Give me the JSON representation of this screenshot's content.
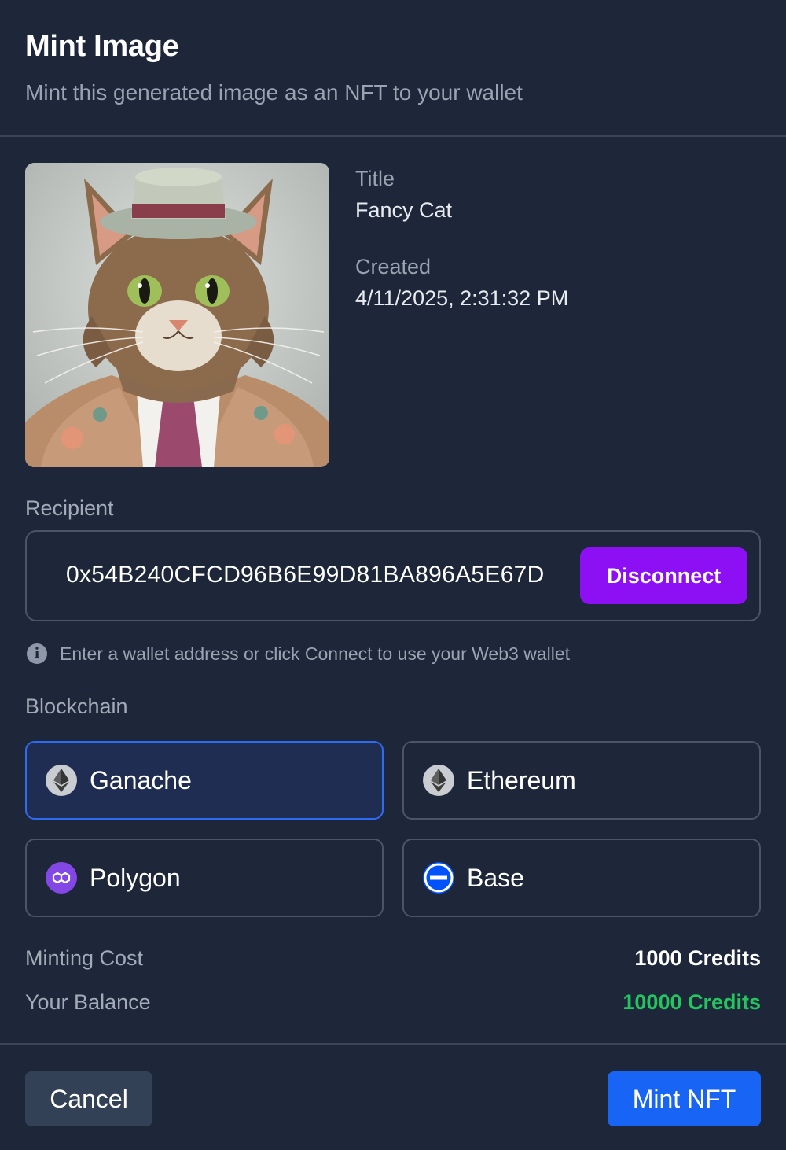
{
  "dialog": {
    "title": "Mint Image",
    "subtitle": "Mint this generated image as an NFT to your wallet"
  },
  "image": {
    "title_label": "Title",
    "title_value": "Fancy Cat",
    "created_label": "Created",
    "created_value": "4/11/2025, 2:31:32 PM"
  },
  "recipient": {
    "label": "Recipient",
    "address": "0x54B240CFCD96B6E99D81BA896A5E67D",
    "disconnect_label": "Disconnect",
    "hint": "Enter a wallet address or click Connect to use your Web3 wallet"
  },
  "blockchain": {
    "label": "Blockchain",
    "options": [
      {
        "name": "Ganache",
        "icon": "ethereum-icon",
        "selected": true
      },
      {
        "name": "Ethereum",
        "icon": "ethereum-icon",
        "selected": false
      },
      {
        "name": "Polygon",
        "icon": "polygon-icon",
        "selected": false
      },
      {
        "name": "Base",
        "icon": "base-icon",
        "selected": false
      }
    ]
  },
  "cost": {
    "minting_label": "Minting Cost",
    "minting_value": "1000 Credits",
    "balance_label": "Your Balance",
    "balance_value": "10000 Credits",
    "balance_color": "#22c55e"
  },
  "actions": {
    "cancel_label": "Cancel",
    "mint_label": "Mint NFT"
  },
  "colors": {
    "background": "#1e2739",
    "accent_purple": "#8d10f5",
    "accent_blue": "#1764f5",
    "selected_border": "#2f6bf0"
  }
}
